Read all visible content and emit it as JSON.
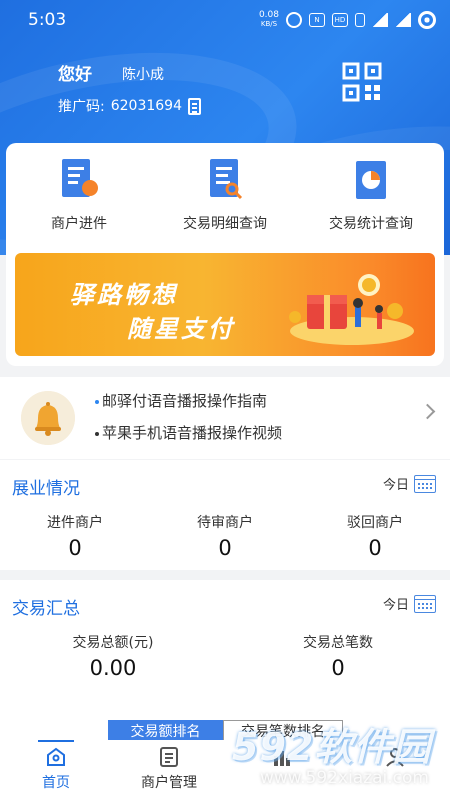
{
  "status_bar": {
    "time": "5:03",
    "speed_value": "0.08",
    "speed_unit": "KB/S",
    "icons": [
      "alarm-icon",
      "nfc-icon",
      "volte-icon",
      "vibrate-icon",
      "signal-4g-icon",
      "signal-4g-icon",
      "battery-icon"
    ]
  },
  "header": {
    "greeting": "您好",
    "user_name": "陈小成",
    "promo_label": "推广码:",
    "promo_code": "62031694"
  },
  "quick_menu": [
    {
      "label": "商户进件",
      "icon": "merchant-onboard-icon"
    },
    {
      "label": "交易明细查询",
      "icon": "transaction-detail-icon"
    },
    {
      "label": "交易统计查询",
      "icon": "transaction-stats-icon"
    }
  ],
  "banner": {
    "line1": "驿路畅想",
    "line2": "随星支付"
  },
  "notices": [
    {
      "text": "邮驿付语音播报操作指南",
      "dot_color": "#2d86f0"
    },
    {
      "text": "苹果手机语音播报操作视频",
      "dot_color": "#333333"
    }
  ],
  "business": {
    "title": "展业情况",
    "period": "今日",
    "items": [
      {
        "label": "进件商户",
        "value": "0"
      },
      {
        "label": "待审商户",
        "value": "0"
      },
      {
        "label": "驳回商户",
        "value": "0"
      }
    ]
  },
  "trade_summary": {
    "title": "交易汇总",
    "period": "今日",
    "items": [
      {
        "label": "交易总额(元)",
        "value": "0.00"
      },
      {
        "label": "交易总笔数",
        "value": "0"
      }
    ]
  },
  "rank_tabs": [
    "交易额排名",
    "交易笔数排名"
  ],
  "tabbar": [
    {
      "label": "首页",
      "icon": "home-icon",
      "active": true
    },
    {
      "label": "商户管理",
      "icon": "merchant-manage-icon",
      "active": false
    },
    {
      "label": "",
      "icon": "stats-icon",
      "active": false
    },
    {
      "label": "",
      "icon": "profile-icon",
      "active": false
    }
  ],
  "watermark": {
    "text": "592软件园",
    "url": "www.592xiazai.com"
  },
  "colors": {
    "brand_blue": "#1f6fe0",
    "banner_orange": "#f8b531"
  }
}
